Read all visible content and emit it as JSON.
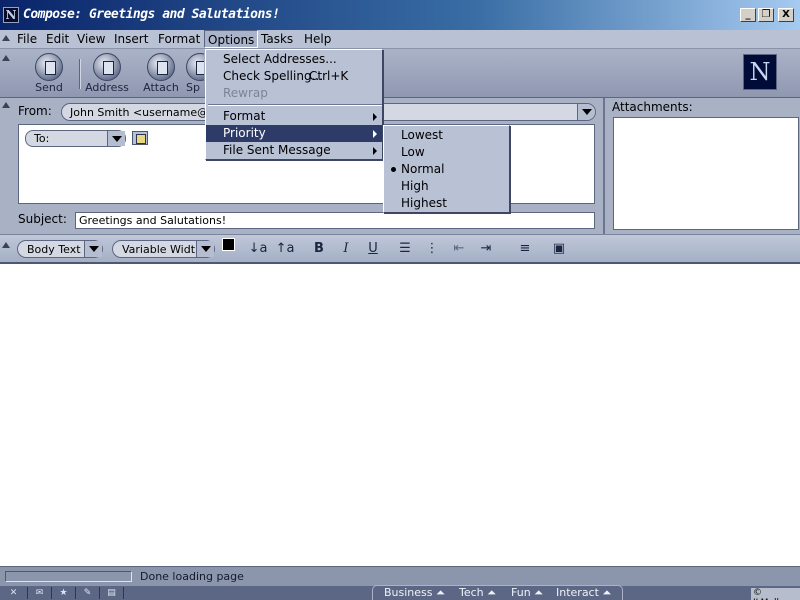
{
  "window": {
    "title": "Compose: Greetings and Salutations!",
    "icon_letter": "N",
    "controls": [
      "_",
      "❐",
      "X"
    ]
  },
  "menubar": {
    "items": [
      "File",
      "Edit",
      "View",
      "Insert",
      "Format",
      "Options",
      "Tasks",
      "Help"
    ],
    "active": "Options"
  },
  "toolbar": {
    "buttons": [
      "Send",
      "Address",
      "Attach",
      "Sp"
    ],
    "logo_letter": "N"
  },
  "compose": {
    "from_label": "From:",
    "from_value": "John Smith <username@ser",
    "to_label": "To:",
    "subject_label": "Subject:",
    "subject_value": "Greetings and Salutations!",
    "attachments_label": "Attachments:"
  },
  "format_toolbar": {
    "paragraph_style": "Body Text",
    "font": "Variable Width",
    "buttons": [
      "↓a",
      "↑a",
      "B",
      "I",
      "U",
      "☰",
      "⋮",
      "⇤",
      "⇥",
      "≡",
      "▣"
    ],
    "text_color": "#000000",
    "bg_color": "#ffffff"
  },
  "options_menu": {
    "items": [
      {
        "label": "Select Addresses...",
        "shortcut": ""
      },
      {
        "label": "Check Spelling...",
        "shortcut": "Ctrl+K"
      },
      {
        "label": "Rewrap",
        "shortcut": "",
        "disabled": true
      },
      {
        "label": "Format",
        "submenu": true
      },
      {
        "label": "Priority",
        "submenu": true,
        "highlighted": true
      },
      {
        "label": "File Sent Message",
        "submenu": true
      }
    ]
  },
  "priority_submenu": {
    "items": [
      "Lowest",
      "Low",
      "Normal",
      "High",
      "Highest"
    ],
    "selected": "Normal"
  },
  "status": {
    "text": "Done loading page",
    "progress": 0
  },
  "taskbar": {
    "quicklinks": [
      "Business",
      "Tech",
      "Fun",
      "Interact"
    ],
    "credit": "© JLMeller"
  }
}
